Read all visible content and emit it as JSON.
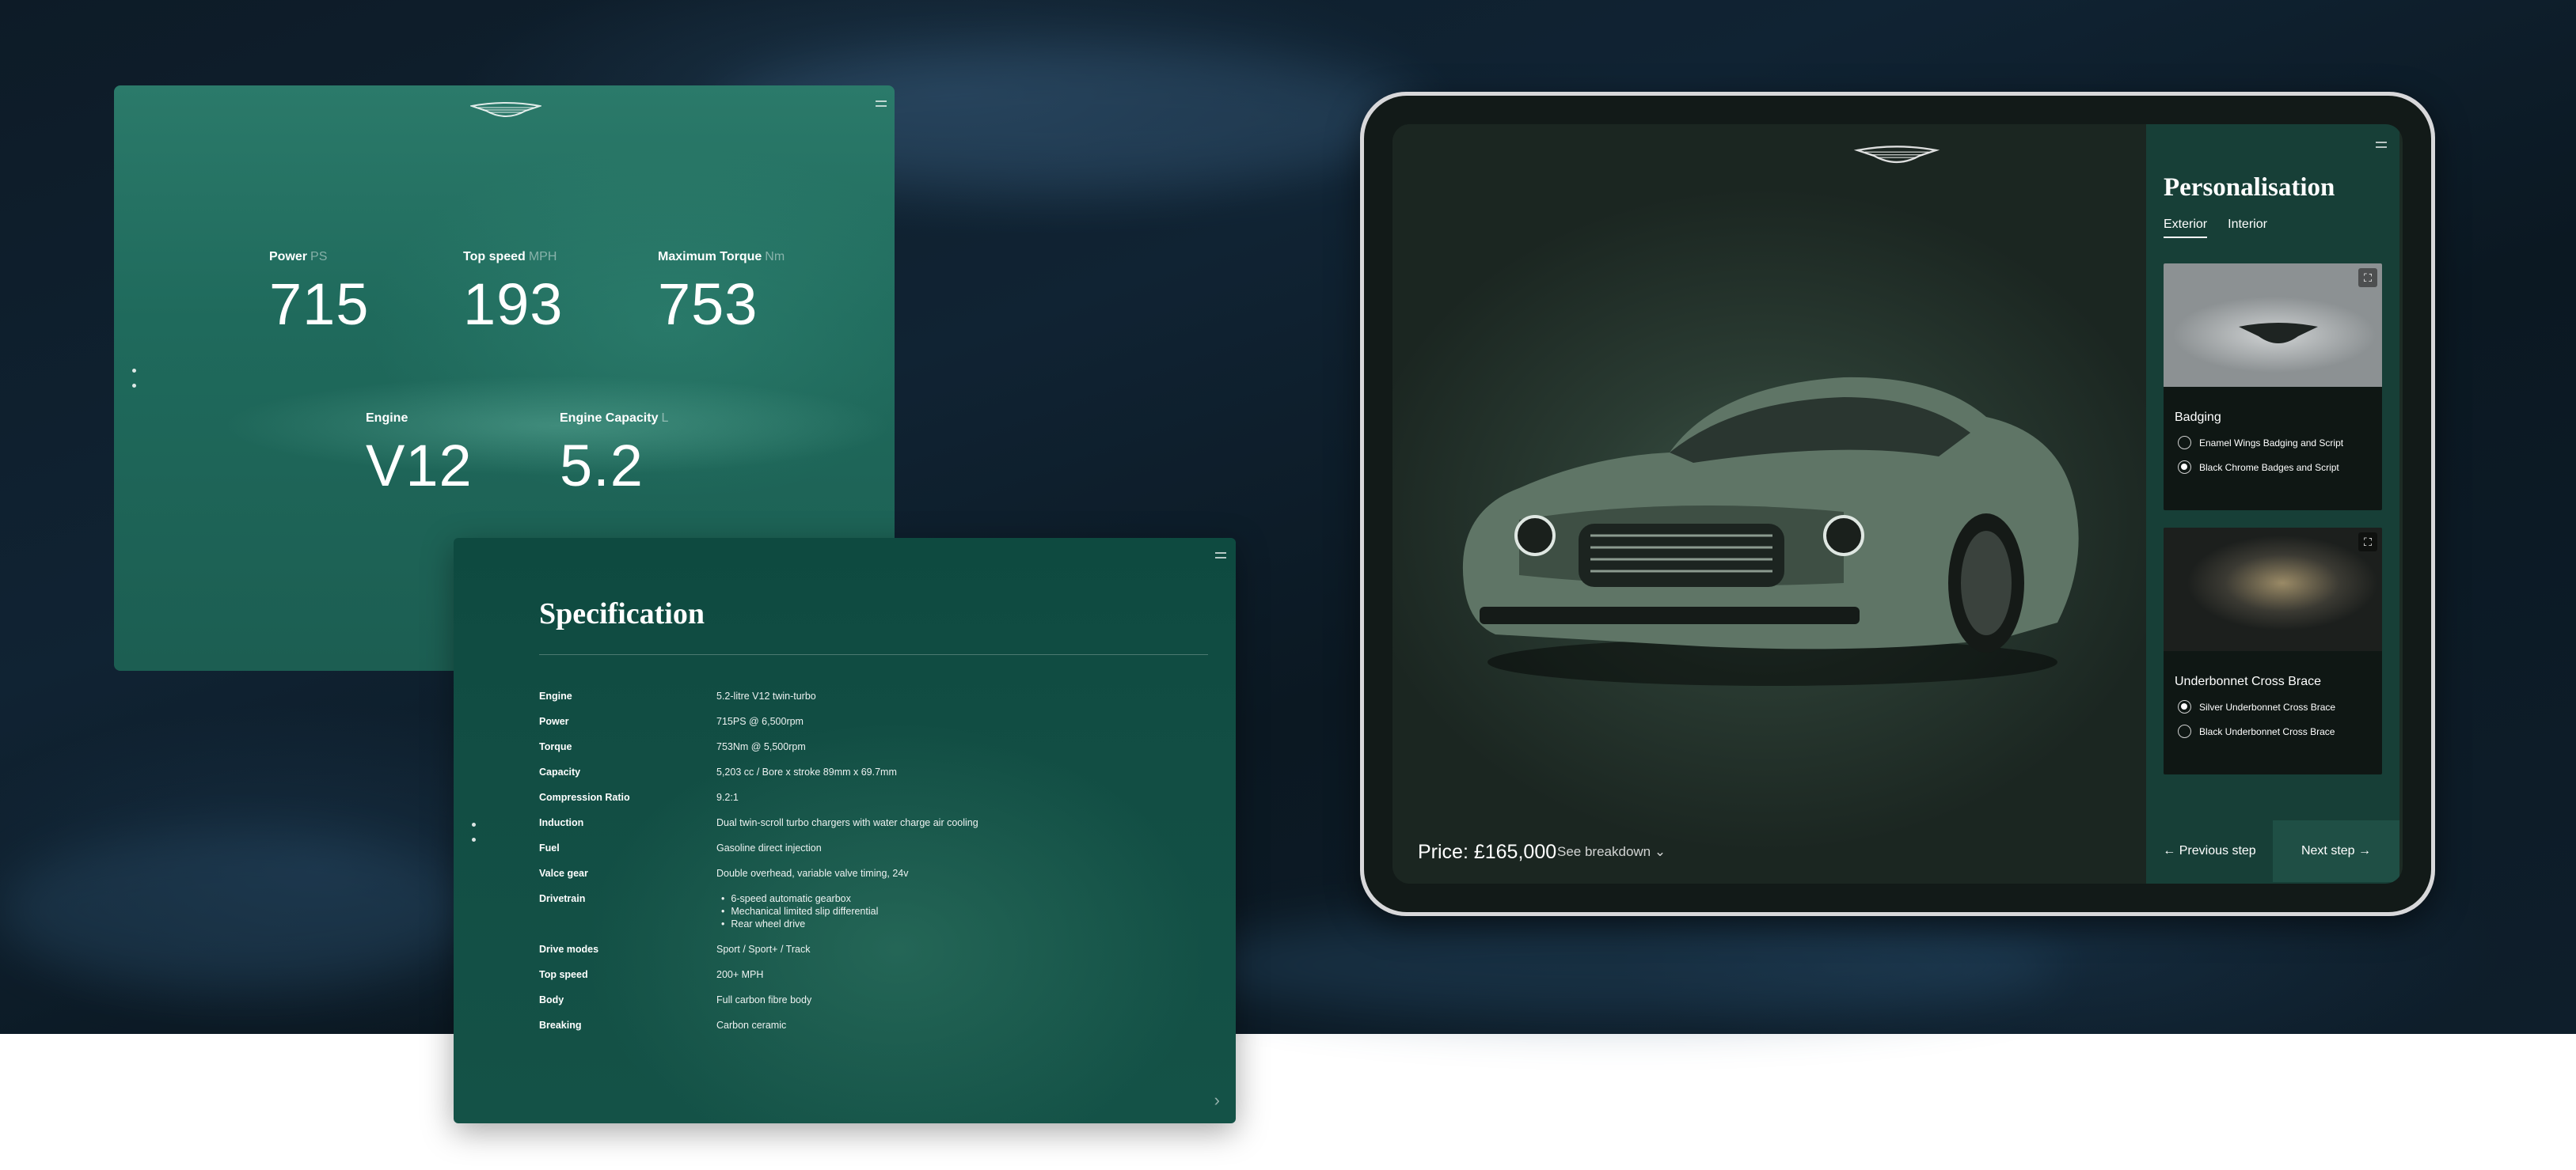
{
  "stats_panel": {
    "stats": [
      {
        "label": "Power",
        "unit": "PS",
        "value": "715"
      },
      {
        "label": "Top speed",
        "unit": "MPH",
        "value": "193"
      },
      {
        "label": "Maximum Torque",
        "unit": "Nm",
        "value": "753"
      },
      {
        "label": "Engine",
        "unit": "",
        "value": "V12"
      },
      {
        "label": "Engine Capacity",
        "unit": "L",
        "value": "5.2"
      }
    ]
  },
  "spec_panel": {
    "title": "Specification",
    "rows": [
      {
        "key": "Engine",
        "value": "5.2-litre V12 twin-turbo"
      },
      {
        "key": "Power",
        "value": "715PS @ 6,500rpm"
      },
      {
        "key": "Torque",
        "value": "753Nm @ 5,500rpm"
      },
      {
        "key": "Capacity",
        "value": "5,203 cc / Bore x stroke 89mm x 69.7mm"
      },
      {
        "key": "Compression Ratio",
        "value": "9.2:1"
      },
      {
        "key": "Induction",
        "value": "Dual twin-scroll turbo chargers with water charge air cooling"
      },
      {
        "key": "Fuel",
        "value": "Gasoline direct injection"
      },
      {
        "key": "Valce gear",
        "value": "Double overhead, variable valve timing, 24v"
      },
      {
        "key": "Drivetrain",
        "items": [
          "6-speed automatic gearbox",
          "Mechanical limited slip differential",
          "Rear wheel drive"
        ]
      },
      {
        "key": "Drive modes",
        "value": "Sport / Sport+ / Track"
      },
      {
        "key": "Top speed",
        "value": "200+ MPH"
      },
      {
        "key": "Body",
        "value": "Full carbon fibre body"
      },
      {
        "key": "Breaking",
        "value": "Carbon ceramic"
      }
    ]
  },
  "configurator": {
    "price": "Price: £165,000",
    "breakdown_label": "See breakdown",
    "title": "Personalisation",
    "tabs": [
      "Exterior",
      "Interior"
    ],
    "options": [
      {
        "name": "Badging",
        "choices": [
          {
            "label": "Enamel Wings Badging and Script",
            "selected": false
          },
          {
            "label": "Black Chrome Badges and Script",
            "selected": true
          }
        ]
      },
      {
        "name": "Underbonnet Cross Brace",
        "choices": [
          {
            "label": "Silver Underbonnet Cross Brace",
            "selected": true
          },
          {
            "label": "Black Underbonnet Cross Brace",
            "selected": false
          }
        ]
      }
    ],
    "prev_label": "Previous step",
    "next_label": "Next step"
  },
  "colors": {
    "accent_green": "#1f6a5c",
    "spec_green": "#124e44",
    "sidebar": "#173f37",
    "background": "#0d1b27"
  },
  "icons": [
    "wings-logo-icon",
    "menu-icon",
    "vertical-dots-icon",
    "chevron-right-icon",
    "chevron-down-icon",
    "expand-icon",
    "arrow-left-icon",
    "arrow-right-icon"
  ]
}
